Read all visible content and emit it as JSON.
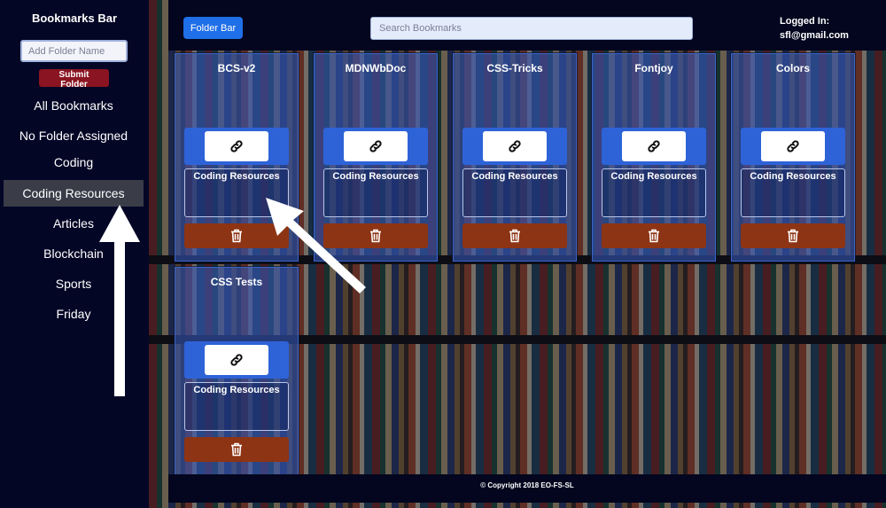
{
  "sidebar": {
    "title": "Bookmarks Bar",
    "folder_input_placeholder": "Add Folder Name",
    "submit_label": "Submit Folder",
    "items": [
      {
        "label": "All Bookmarks",
        "active": false
      },
      {
        "label": "No Folder Assigned",
        "active": false
      },
      {
        "label": "Coding",
        "active": false
      },
      {
        "label": "Coding Resources",
        "active": true
      },
      {
        "label": "Articles",
        "active": false
      },
      {
        "label": "Blockchain",
        "active": false
      },
      {
        "label": "Sports",
        "active": false
      },
      {
        "label": "Friday",
        "active": false
      }
    ]
  },
  "header": {
    "folder_bar_label": "Folder Bar",
    "search_placeholder": "Search Bookmarks",
    "login_label": "Logged In:",
    "login_email": "sfl@gmail.com"
  },
  "cards": [
    {
      "title": "BCS-v2",
      "folder": "Coding Resources"
    },
    {
      "title": "MDNWbDoc",
      "folder": "Coding Resources"
    },
    {
      "title": "CSS-Tricks",
      "folder": "Coding Resources"
    },
    {
      "title": "Fontjoy",
      "folder": "Coding Resources"
    },
    {
      "title": "Colors",
      "folder": "Coding Resources"
    },
    {
      "title": "CSS Tests",
      "folder": "Coding Resources"
    }
  ],
  "icons": {
    "link": "link-icon",
    "delete": "trash-icon",
    "annotation": "arrow-icon"
  },
  "footer": {
    "copyright": "© Copyright 2018 EO-FS-SL"
  },
  "colors": {
    "sidebar_bg": "#040626",
    "accent_blue": "#1f6fe8",
    "submit_red": "#8a1421",
    "delete_orange": "#8d3414",
    "card_blue": "#3456b2",
    "active_item": "#3a3c48"
  }
}
